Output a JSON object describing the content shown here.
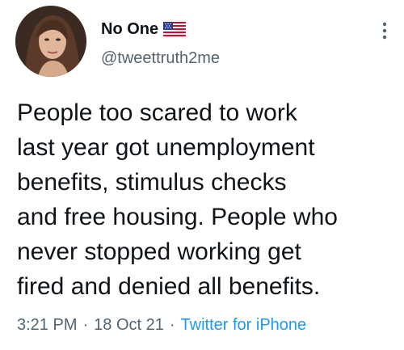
{
  "tweet": {
    "author": {
      "display_name": "No One",
      "flag_icon": "us-flag-icon",
      "handle": "@tweettruth2me"
    },
    "menu_icon": "more-vertical-icon",
    "text_lines": [
      "People too scared to work",
      "last year got unemployment",
      "benefits, stimulus checks",
      "and free housing. People who",
      "never stopped working get",
      "fired and denied all benefits."
    ],
    "time": "3:21 PM",
    "separator": "·",
    "date": "18 Oct 21",
    "source": "Twitter for iPhone"
  },
  "colors": {
    "text": "#0f1419",
    "secondary": "#536471",
    "link": "#1d9bf0",
    "background": "#ffffff"
  }
}
